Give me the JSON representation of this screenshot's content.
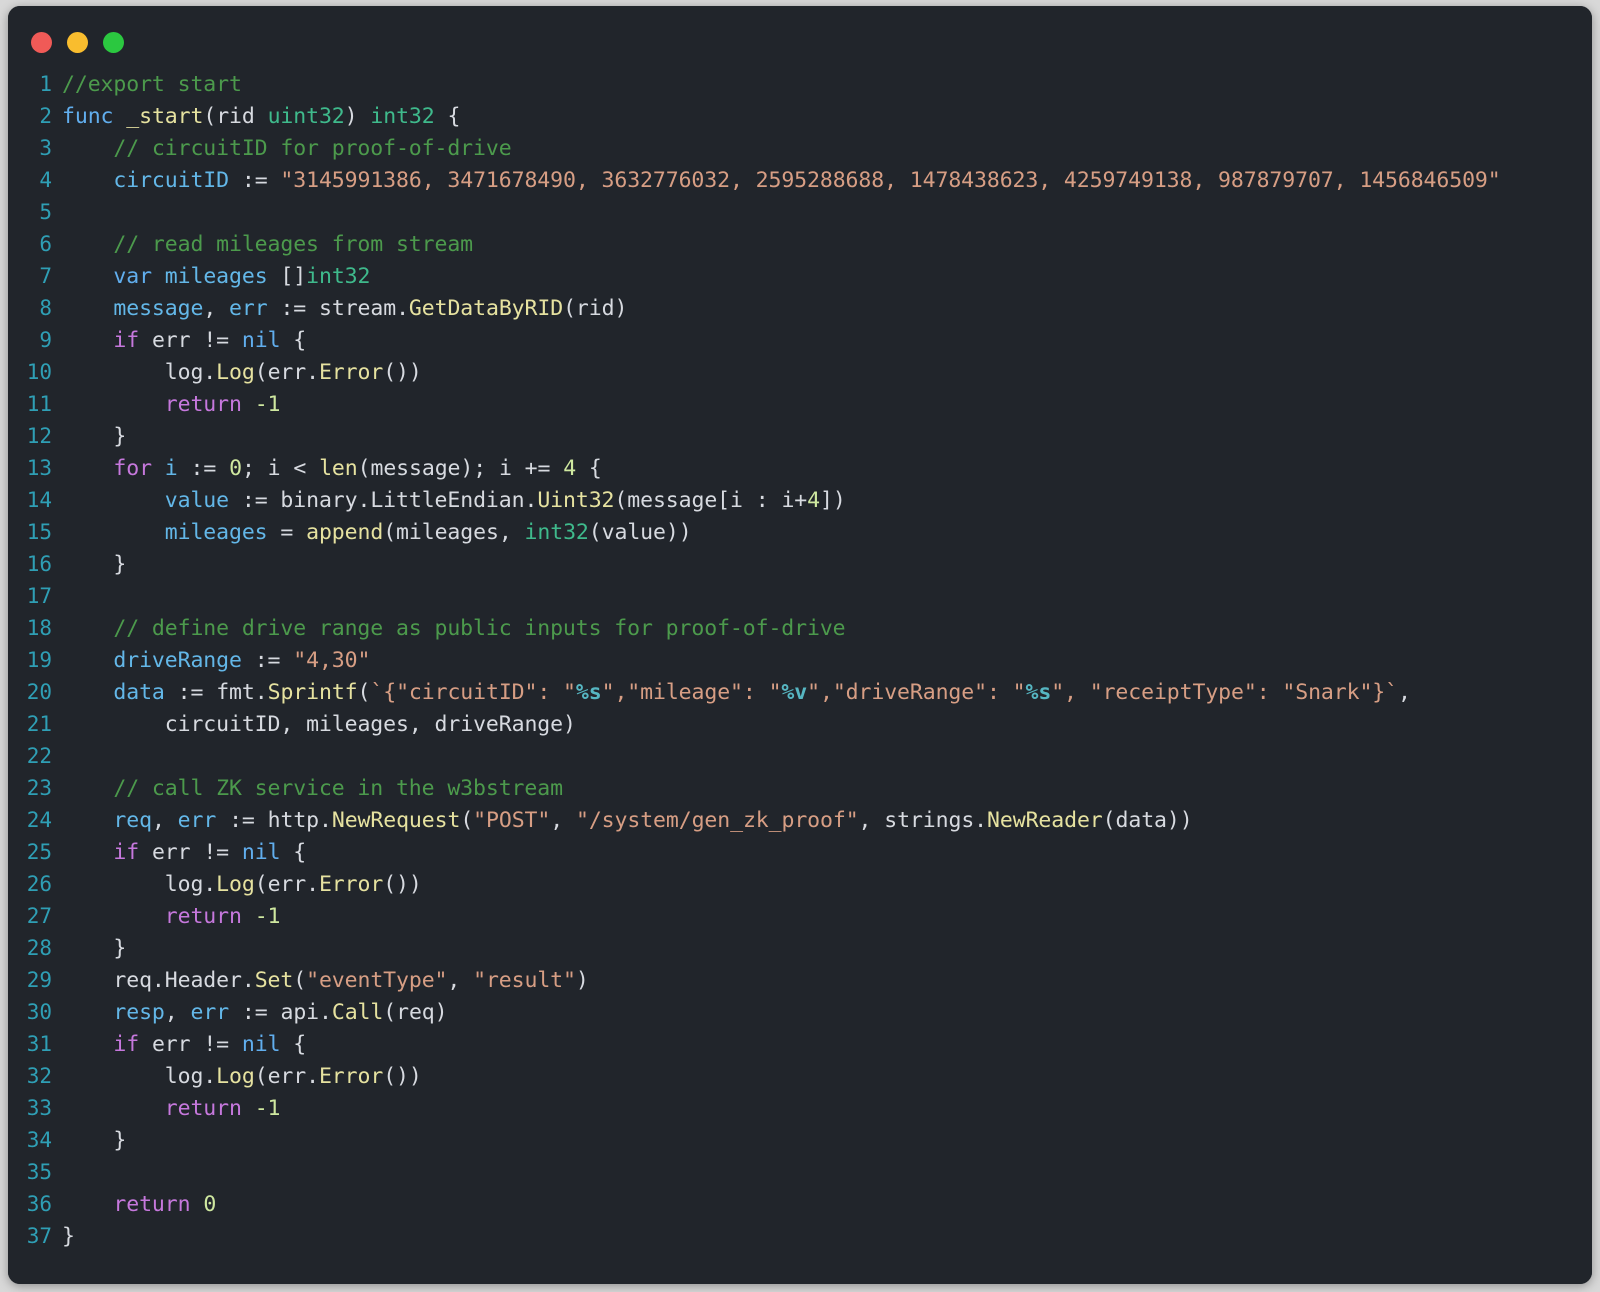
{
  "window": {
    "title": "",
    "traffic_lights": [
      {
        "name": "close-button",
        "color": "#f05a57"
      },
      {
        "name": "minimize-button",
        "color": "#f9bd2e"
      },
      {
        "name": "maximize-button",
        "color": "#2bc840"
      }
    ]
  },
  "editor": {
    "language": "Go",
    "theme": "One Dark",
    "background": "#21252b",
    "line_number_color": "#2f9fb5",
    "first_line": 1,
    "last_line": 37,
    "total_lines": 37,
    "line_numbers": [
      1,
      2,
      3,
      4,
      5,
      6,
      7,
      8,
      9,
      10,
      11,
      12,
      13,
      14,
      15,
      16,
      17,
      18,
      19,
      20,
      21,
      22,
      23,
      24,
      25,
      26,
      27,
      28,
      29,
      30,
      31,
      32,
      33,
      34,
      35,
      36,
      37
    ],
    "lines_plain": [
      "//export start",
      "func _start(rid uint32) int32 {",
      "    // circuitID for proof-of-drive",
      "    circuitID := \"3145991386, 3471678490, 3632776032, 2595288688, 1478438623, 4259749138, 987879707, 1456846509\"",
      "",
      "    // read mileages from stream",
      "    var mileages []int32",
      "    message, err := stream.GetDataByRID(rid)",
      "    if err != nil {",
      "        log.Log(err.Error())",
      "        return -1",
      "    }",
      "    for i := 0; i < len(message); i += 4 {",
      "        value := binary.LittleEndian.Uint32(message[i : i+4])",
      "        mileages = append(mileages, int32(value))",
      "    }",
      "",
      "    // define drive range as public inputs for proof-of-drive",
      "    driveRange := \"4,30\"",
      "    data := fmt.Sprintf(`{\"circuitID\": \"%s\",\"mileage\": \"%v\",\"driveRange\": \"%s\", \"receiptType\": \"Snark\"}`,",
      "        circuitID, mileages, driveRange)",
      "",
      "    // call ZK service in the w3bstream",
      "    req, err := http.NewRequest(\"POST\", \"/system/gen_zk_proof\", strings.NewReader(data))",
      "    if err != nil {",
      "        log.Log(err.Error())",
      "        return -1",
      "    }",
      "    req.Header.Set(\"eventType\", \"result\")",
      "    resp, err := api.Call(req)",
      "    if err != nil {",
      "        log.Log(err.Error())",
      "        return -1",
      "    }",
      "",
      "    return 0",
      "}"
    ],
    "lines_html": [
      "<span class=\"cm\">//export start</span>",
      "<span class=\"kb\">func</span> <span class=\"fn\">_start</span><span class=\"pn\">(</span>rid <span class=\"ty\">uint32</span><span class=\"pn\">)</span> <span class=\"ty\">int32</span> <span class=\"pn\">{</span>",
      "    <span class=\"cm\">// circuitID for proof-of-drive</span>",
      "    <span class=\"vr\">circuitID</span> <span class=\"pn\">:=</span> <span class=\"st\">\"3145991386, 3471678490, 3632776032, 2595288688, 1478438623, 4259749138, 987879707, 1456846509\"</span>",
      "",
      "    <span class=\"cm\">// read mileages from stream</span>",
      "    <span class=\"kb\">var</span> <span class=\"vr\">mileages</span> <span class=\"pn\">[]</span><span class=\"ty\">int32</span>",
      "    <span class=\"vr\">message</span><span class=\"pn\">,</span> <span class=\"vr\">err</span> <span class=\"pn\">:=</span> <span class=\"pn\">stream.</span><span class=\"fn\">GetDataByRID</span><span class=\"pn\">(</span>rid<span class=\"pn\">)</span>",
      "    <span class=\"kw\">if</span> err <span class=\"pn\">!=</span> <span class=\"kb\">nil</span> <span class=\"pn\">{</span>",
      "        <span class=\"pn\">log.</span><span class=\"fn\">Log</span><span class=\"pn\">(</span>err.<span class=\"fn\">Error</span><span class=\"pn\">())</span>",
      "        <span class=\"kw\">return</span> <span class=\"nu\">-1</span>",
      "    <span class=\"pn\">}</span>",
      "    <span class=\"kw\">for</span> <span class=\"vr\">i</span> <span class=\"pn\">:=</span> <span class=\"nu\">0</span><span class=\"pn\">;</span> i <span class=\"pn\">&lt;</span> <span class=\"fn\">len</span><span class=\"pn\">(</span>message<span class=\"pn\">);</span> i <span class=\"pn\">+=</span> <span class=\"nu\">4</span> <span class=\"pn\">{</span>",
      "        <span class=\"vr\">value</span> <span class=\"pn\">:=</span> <span class=\"pn\">binary.LittleEndian.</span><span class=\"fn\">Uint32</span><span class=\"pn\">(</span>message<span class=\"pn\">[</span>i <span class=\"pn\">:</span> i<span class=\"pn\">+</span><span class=\"nu\">4</span><span class=\"pn\">])</span>",
      "        <span class=\"vr\">mileages</span> <span class=\"pn\">=</span> <span class=\"fn\">append</span><span class=\"pn\">(</span>mileages<span class=\"pn\">,</span> <span class=\"ty\">int32</span><span class=\"pn\">(</span>value<span class=\"pn\">))</span>",
      "    <span class=\"pn\">}</span>",
      "",
      "    <span class=\"cm\">// define drive range as public inputs for proof-of-drive</span>",
      "    <span class=\"vr\">driveRange</span> <span class=\"pn\">:=</span> <span class=\"st\">\"4,30\"</span>",
      "    <span class=\"vr\">data</span> <span class=\"pn\">:=</span> <span class=\"pn\">fmt.</span><span class=\"fn\">Sprintf</span><span class=\"pn\">(</span><span class=\"st\">`{\"circuitID\": \"</span><span class=\"vb\">%s</span><span class=\"st\">\",\"mileage\": \"</span><span class=\"vb\">%v</span><span class=\"st\">\",\"driveRange\": \"</span><span class=\"vb\">%s</span><span class=\"st\">\", \"receiptType\": \"Snark\"}`</span><span class=\"pn\">,</span>",
      "        circuitID<span class=\"pn\">,</span> mileages<span class=\"pn\">,</span> driveRange<span class=\"pn\">)</span>",
      "",
      "    <span class=\"cm\">// call ZK service in the w3bstream</span>",
      "    <span class=\"vr\">req</span><span class=\"pn\">,</span> <span class=\"vr\">err</span> <span class=\"pn\">:=</span> <span class=\"pn\">http.</span><span class=\"fn\">NewRequest</span><span class=\"pn\">(</span><span class=\"st\">\"POST\"</span><span class=\"pn\">,</span> <span class=\"st\">\"/system/gen_zk_proof\"</span><span class=\"pn\">,</span> <span class=\"pn\">strings.</span><span class=\"fn\">NewReader</span><span class=\"pn\">(</span>data<span class=\"pn\">))</span>",
      "    <span class=\"kw\">if</span> err <span class=\"pn\">!=</span> <span class=\"kb\">nil</span> <span class=\"pn\">{</span>",
      "        <span class=\"pn\">log.</span><span class=\"fn\">Log</span><span class=\"pn\">(</span>err.<span class=\"fn\">Error</span><span class=\"pn\">())</span>",
      "        <span class=\"kw\">return</span> <span class=\"nu\">-1</span>",
      "    <span class=\"pn\">}</span>",
      "    <span class=\"pn\">req.Header.</span><span class=\"fn\">Set</span><span class=\"pn\">(</span><span class=\"st\">\"eventType\"</span><span class=\"pn\">,</span> <span class=\"st\">\"result\"</span><span class=\"pn\">)</span>",
      "    <span class=\"vr\">resp</span><span class=\"pn\">,</span> <span class=\"vr\">err</span> <span class=\"pn\">:=</span> <span class=\"pn\">api.</span><span class=\"fn\">Call</span><span class=\"pn\">(</span>req<span class=\"pn\">)</span>",
      "    <span class=\"kw\">if</span> err <span class=\"pn\">!=</span> <span class=\"kb\">nil</span> <span class=\"pn\">{</span>",
      "        <span class=\"pn\">log.</span><span class=\"fn\">Log</span><span class=\"pn\">(</span>err.<span class=\"fn\">Error</span><span class=\"pn\">())</span>",
      "        <span class=\"kw\">return</span> <span class=\"nu\">-1</span>",
      "    <span class=\"pn\">}</span>",
      "",
      "    <span class=\"kw\">return</span> <span class=\"nu\">0</span>",
      "<span class=\"pn\">}</span>"
    ]
  }
}
